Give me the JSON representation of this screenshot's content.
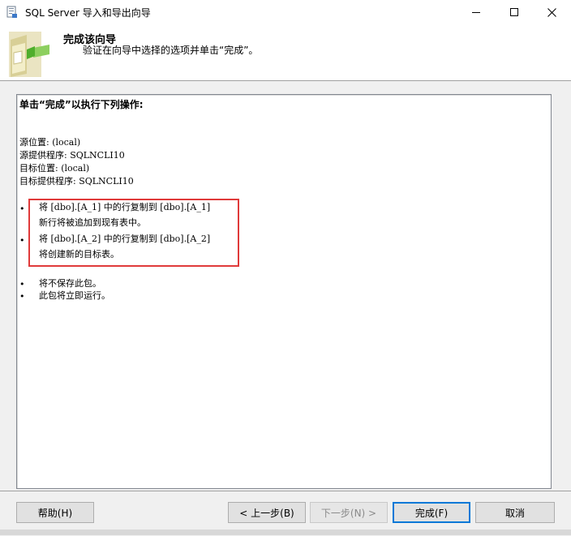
{
  "window": {
    "title": "SQL Server 导入和导出向导",
    "icon": "sql-server-wizard-icon"
  },
  "header": {
    "title": "完成该向导",
    "subtitle": "验证在向导中选择的选项并单击“完成”。",
    "icon": "wizard-folder-icon"
  },
  "summary": {
    "heading": "单击“完成”以执行下列操作:",
    "source_location": "源位置: (local)",
    "source_provider": "源提供程序: SQLNCLI10",
    "target_location": "目标位置: (local)",
    "target_provider": "目标提供程序: SQLNCLI10",
    "items": [
      {
        "line1": "将 [dbo].[A_1] 中的行复制到 [dbo].[A_1]",
        "line2": "新行将被追加到现有表中。"
      },
      {
        "line1": "将 [dbo].[A_2] 中的行复制到 [dbo].[A_2]",
        "line2": "将创建新的目标表。"
      },
      {
        "line1": "将不保存此包。"
      },
      {
        "line1": "此包将立即运行。"
      }
    ],
    "bullet": "•",
    "highlight_color": "#e03a3a"
  },
  "buttons": {
    "help": "帮助(H)",
    "back": "< 上一步(B)",
    "next": "下一步(N) >",
    "finish": "完成(F)",
    "cancel": "取消"
  }
}
